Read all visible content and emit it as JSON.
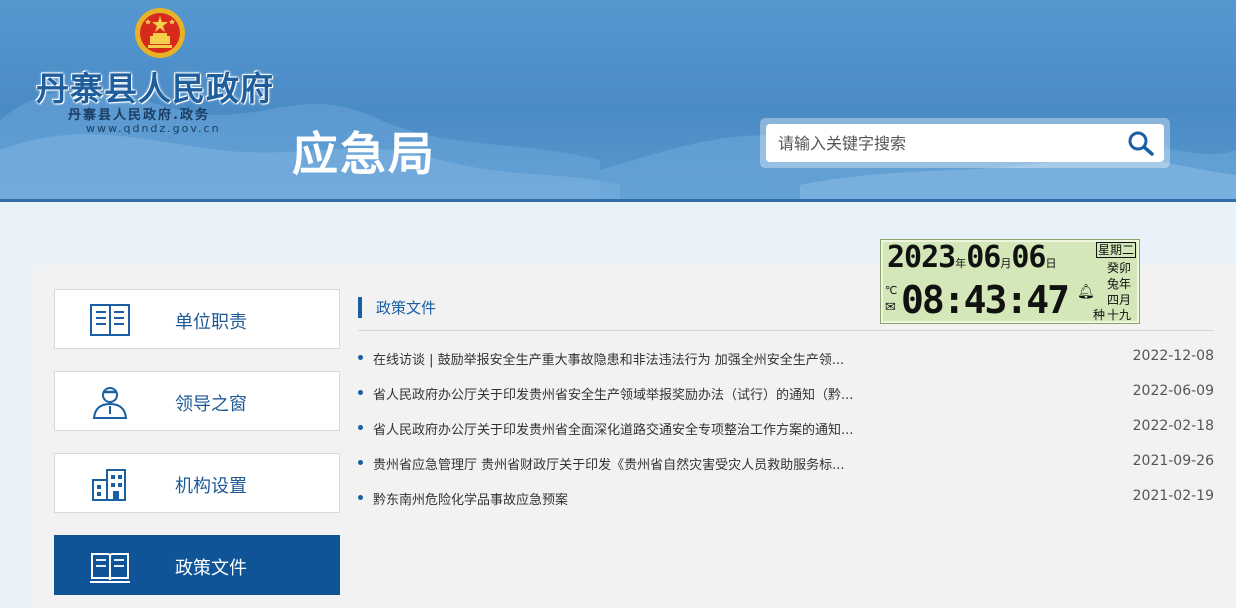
{
  "header": {
    "site_name": "丹寨县人民政府",
    "site_sub": "丹寨县人民政府.政务",
    "site_url": "www.qdndz.gov.cn",
    "page_title": "应急局"
  },
  "search": {
    "placeholder": "请输入关键字搜索",
    "value": ""
  },
  "sidebar": {
    "items": [
      {
        "label": "单位职责",
        "icon": "book-icon",
        "active": false
      },
      {
        "label": "领导之窗",
        "icon": "user-icon",
        "active": false
      },
      {
        "label": "机构设置",
        "icon": "building-icon",
        "active": false
      },
      {
        "label": "政策文件",
        "icon": "open-book-icon",
        "active": true
      }
    ]
  },
  "section": {
    "title": "政策文件"
  },
  "news": [
    {
      "title": "在线访谈 | 鼓励举报安全生产重大事故隐患和非法违法行为  加强全州安全生产领...",
      "date": "2022-12-08"
    },
    {
      "title": "省人民政府办公厅关于印发贵州省安全生产领域举报奖励办法（试行）的通知（黔...",
      "date": "2022-06-09"
    },
    {
      "title": "省人民政府办公厅关于印发贵州省全面深化道路交通安全专项整治工作方案的通知...",
      "date": "2022-02-18"
    },
    {
      "title": "贵州省应急管理厅 贵州省财政厅关于印发《贵州省自然灾害受灾人员救助服务标...",
      "date": "2021-09-26"
    },
    {
      "title": "黔东南州危险化学品事故应急预案",
      "date": "2021-02-19"
    }
  ],
  "clock": {
    "year": "2023",
    "year_unit": "年",
    "month": "06",
    "month_unit": "月",
    "day": "06",
    "day_unit": "日",
    "weekday": "星期二",
    "time": "08:43:47",
    "temp_unit": "℃",
    "lunar_year_1": "癸卯",
    "lunar_year_2": "兔年",
    "lunar_month": "四月",
    "lunar_day": "十九",
    "lunar_day_prefix": "种"
  },
  "colors": {
    "header_blue": "#4a8bc6",
    "brand_blue": "#1a5fa3",
    "active_bg": "#0e5497",
    "lcd_bg": "#d3e7b8"
  }
}
